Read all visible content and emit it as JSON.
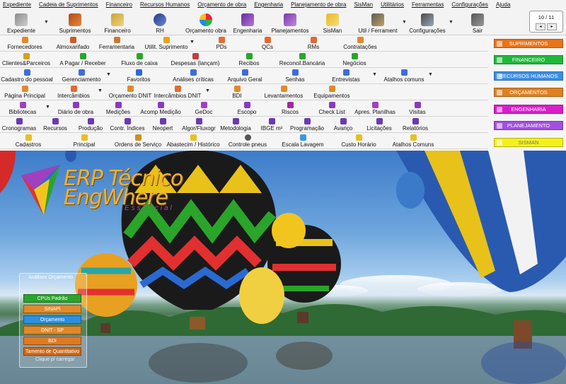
{
  "menu": [
    "Expediente",
    "Cadeia de Suprimentos",
    "Financeiro",
    "Recursos Humanos",
    "Orçamento de obra",
    "Engenharia",
    "Planejamento de obra",
    "SisMan",
    "Utilitários",
    "Ferramentas",
    "Configurações",
    "Ajuda"
  ],
  "toolbar": {
    "items": [
      "Expediente",
      "Suprimentos",
      "Financeiro",
      "RH",
      "Orçamento obra",
      "Engenharia",
      "Planejamentos",
      "SisMan",
      "Util / Ferrament",
      "Configurações",
      "Sair"
    ],
    "pager": "10 / 11",
    "pager_prev": "◂",
    "pager_next": "▸"
  },
  "rows": [
    [
      "Fornecedores",
      "Almoxarifado",
      "Ferramentaria",
      "Utilit. Suprimento",
      "PDs",
      "QCs",
      "RMs",
      "Contratações"
    ],
    [
      "Clientes&Parceiros",
      "A Pagar / Receber",
      "Fluxo de caixa",
      "Despesas (lançam)",
      "Recibos",
      "Reconcil.Bancária",
      "Negócios"
    ],
    [
      "Cadastro do pessoal",
      "Gerenciamento",
      "Favoritos",
      "Análises críticas",
      "Arquivo Geral",
      "Senhas",
      "Entrevistas",
      "Atalhos comuns"
    ],
    [
      "Página Principal",
      "Intercâmbios",
      "Orçamento DNIT",
      "Intercâmbios DNIT",
      "BDI",
      "Levantamentos",
      "Equipamentos"
    ],
    [
      "Bibliotecas",
      "Diário de obra",
      "Medições",
      "Acomp Medição",
      "GeDoc",
      "Escopo",
      "Riscos",
      "Check List",
      "Apres. Planilhas",
      "Visitas"
    ],
    [
      "Cronogramas",
      "Recursos",
      "Produção",
      "Contr. Índices",
      "Neopert",
      "Algor/Fluxogr",
      "Metodologia",
      "IBGE m²",
      "Programação",
      "Avanço",
      "Licitações",
      "Relatórios"
    ],
    [
      "Cadastros",
      "Principal",
      "Ordens de Serviço",
      "Abastecim / Histórico",
      "Controle pneus",
      "Escala Lavagem",
      "Custo Horário",
      "Atalhos Comuns"
    ]
  ],
  "modules": [
    {
      "label": "SUPRIMENTOS",
      "color": "#e8741a"
    },
    {
      "label": "FINANCEIRO",
      "color": "#1fb83a"
    },
    {
      "label": "RECURSOS HUMANOS",
      "color": "#3b8ee6"
    },
    {
      "label": "ORÇAMENTOS",
      "color": "#e0801e"
    },
    {
      "label": "ENGENHARIA",
      "color": "#d91ec9"
    },
    {
      "label": "PLANEJAMENTO",
      "color": "#a14fe0"
    },
    {
      "label": "SISMAN",
      "color": "#f3f01a"
    }
  ],
  "logo": {
    "line1": "ERP Técnico",
    "line2": "EngWhere",
    "sub": "Essencial"
  },
  "widget": {
    "title": "Análises Orçamento",
    "subtitle": "Importar",
    "buttons": [
      {
        "label": "CPUs Padrão",
        "color": "#2aa52a"
      },
      {
        "label": "SINAPI",
        "color": "#e08a2a"
      },
      {
        "label": "Orçamento",
        "color": "#2c8fe0"
      },
      {
        "label": "DNIT - SP",
        "color": "#e0882a"
      },
      {
        "label": "BDI",
        "color": "#e07a20"
      },
      {
        "label": "Tamento de Quantitativo",
        "color": "#d06a18"
      }
    ],
    "footer": "Clique p/ carregar"
  }
}
